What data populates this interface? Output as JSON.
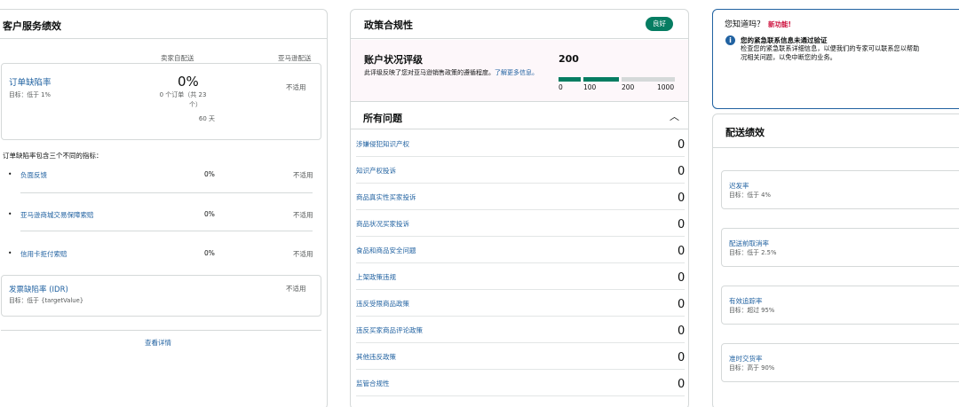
{
  "customer_service": {
    "title": "客户服务绩效",
    "col_seller": "卖家自配送",
    "col_amazon": "亚马逊配送",
    "odr": {
      "label": "订单缺陷率",
      "target": "目标：低于 1%",
      "value": "0%",
      "orders_line1": "0 个订单（共 23",
      "orders_line2": "个）",
      "days": "60 天",
      "amazon": "不适用"
    },
    "intro": "订单缺陷率包含三个不同的指标：",
    "metrics": [
      {
        "label": "负面反馈",
        "value": "0%",
        "amazon": "不适用"
      },
      {
        "label": "亚马逊商城交易保障索赔",
        "value": "0%",
        "amazon": "不适用"
      },
      {
        "label": "信用卡拒付索赔",
        "value": "0%",
        "amazon": "不适用"
      }
    ],
    "idr": {
      "label": "发票缺陷率 (IDR)",
      "target": "目标：低于 {targetValue}",
      "amazon": "不适用"
    },
    "view_details": "查看详情"
  },
  "policy": {
    "title": "政策合规性",
    "badge": "良好",
    "ahr_title": "账户状况评级",
    "ahr_desc": "此评级反映了您对亚马逊销售政策的遵循程度。",
    "ahr_link": "了解更多信息。",
    "score": "200",
    "score_value": 200,
    "ticks": [
      "0",
      "100",
      "200",
      "1000"
    ],
    "all_issues": "所有问题",
    "chevron": "^",
    "issues": [
      {
        "label": "涉嫌侵犯知识产权",
        "count": "0"
      },
      {
        "label": "知识产权投诉",
        "count": "0"
      },
      {
        "label": "商品真实性买家投诉",
        "count": "0"
      },
      {
        "label": "商品状况买家投诉",
        "count": "0"
      },
      {
        "label": "食品和商品安全问题",
        "count": "0"
      },
      {
        "label": "上架政策违规",
        "count": "0"
      },
      {
        "label": "违反受限商品政策",
        "count": "0"
      },
      {
        "label": "违反买家商品评论政策",
        "count": "0"
      },
      {
        "label": "其他违反政策",
        "count": "0"
      },
      {
        "label": "监管合规性",
        "count": "0"
      }
    ],
    "colors": {
      "good": "#067d62",
      "bar_track": "#d5d9d9"
    }
  },
  "did_you_know": {
    "title": "您知道吗？",
    "new": "新功能!",
    "icon": "info-icon",
    "heading": "您的紧急联系信息未通过验证",
    "body1": "检查您的紧急联系详细信息，以便我们的专家可以联系您以帮助",
    "body2": "况相关问题，以免中断您的业务。"
  },
  "shipping": {
    "title": "配送绩效",
    "items": [
      {
        "label": "迟发率",
        "target": "目标：低于 4%"
      },
      {
        "label": "配送前取消率",
        "target": "目标：低于 2.5%"
      },
      {
        "label": "有效追踪率",
        "target": "目标：超过 95%"
      },
      {
        "label": "准时交货率",
        "target": "目标：高于 90%"
      }
    ]
  }
}
